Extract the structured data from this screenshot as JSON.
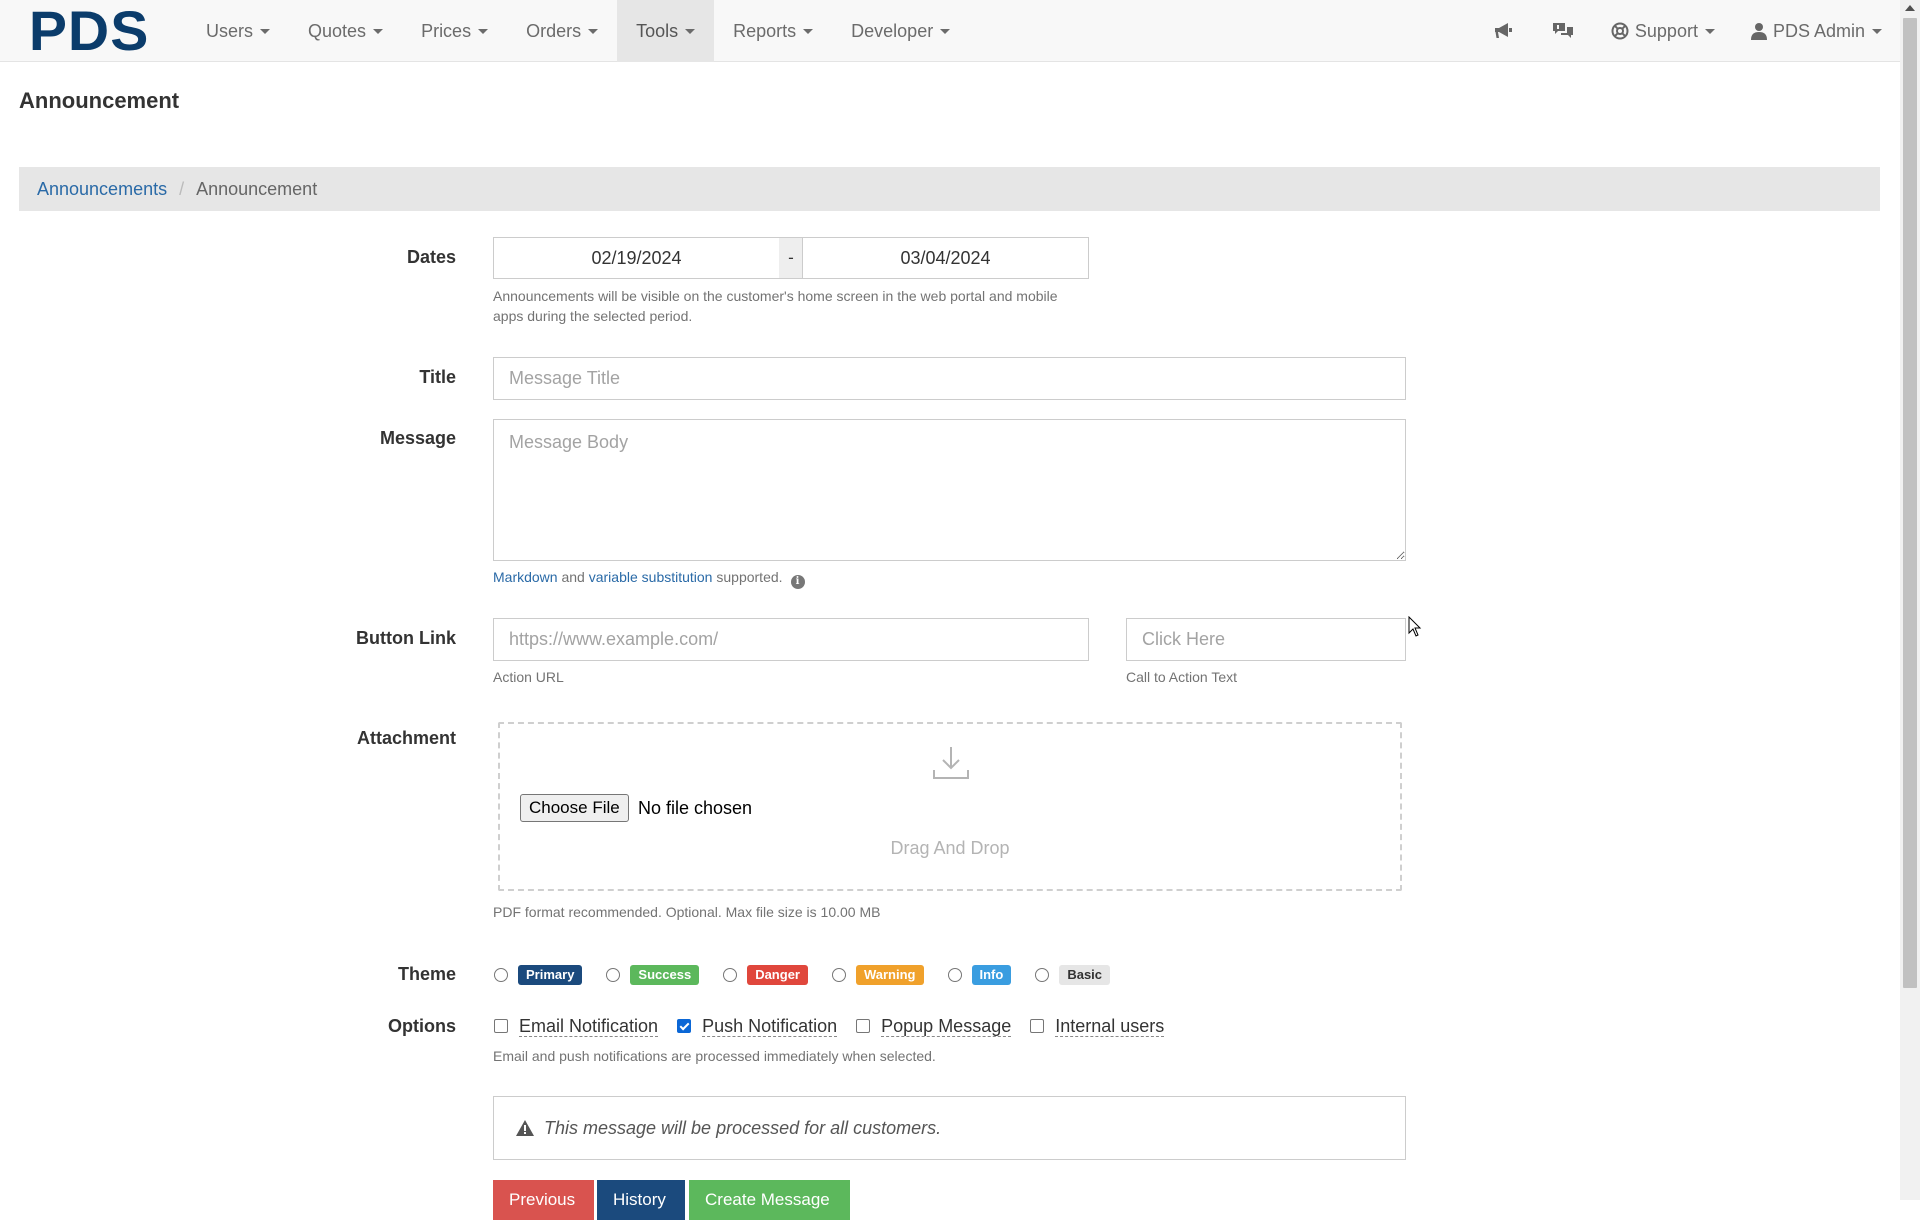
{
  "nav": {
    "brand": "PDS",
    "menu": [
      {
        "label": "Users"
      },
      {
        "label": "Quotes"
      },
      {
        "label": "Prices"
      },
      {
        "label": "Orders"
      },
      {
        "label": "Tools",
        "active": true
      },
      {
        "label": "Reports"
      },
      {
        "label": "Developer"
      }
    ],
    "right": {
      "announcements_icon": "bullhorn-icon",
      "messages_icon": "comments-icon",
      "support_label": "Support",
      "user_label": "PDS Admin"
    }
  },
  "page": {
    "title": "Announcement",
    "breadcrumb": {
      "parent": "Announcements",
      "current": "Announcement"
    }
  },
  "form": {
    "dates": {
      "label": "Dates",
      "start": "02/19/2024",
      "separator": "-",
      "end": "03/04/2024",
      "help_line1": "Announcements will be visible on the customer's home screen in the web portal and mobile",
      "help_line2": "apps during the selected period."
    },
    "title": {
      "label": "Title",
      "value": "",
      "placeholder": "Message Title"
    },
    "message": {
      "label": "Message",
      "value": "",
      "placeholder": "Message Body",
      "help_markdown": "Markdown",
      "help_and": " and ",
      "help_variable": "variable substitution",
      "help_supported": " supported.",
      "info_glyph": "i"
    },
    "button_link": {
      "label": "Button Link",
      "url_placeholder": "https://www.example.com/",
      "url_help": "Action URL",
      "text_placeholder": "Click Here",
      "text_help": "Call to Action Text"
    },
    "attachment": {
      "label": "Attachment",
      "choose_button": "Choose File",
      "file_status": "No file chosen",
      "drop_text": "Drag And Drop",
      "help": "PDF format recommended. Optional. Max file size is 10.00 MB"
    },
    "theme": {
      "label": "Theme",
      "options": [
        {
          "label": "Primary",
          "color": "#1b4a7d"
        },
        {
          "label": "Success",
          "color": "#5cb85c"
        },
        {
          "label": "Danger",
          "color": "#e0473c"
        },
        {
          "label": "Warning",
          "color": "#f0a12b"
        },
        {
          "label": "Info",
          "color": "#3a9de0"
        },
        {
          "label": "Basic",
          "color": "#e6e6e6"
        }
      ]
    },
    "options": {
      "label": "Options",
      "items": [
        {
          "label": "Email Notification",
          "checked": false
        },
        {
          "label": "Push Notification",
          "checked": true
        },
        {
          "label": "Popup Message",
          "checked": false
        },
        {
          "label": "Internal users",
          "checked": false
        }
      ],
      "help": "Email and push notifications are processed immediately when selected."
    },
    "alert": "This message will be processed for all customers.",
    "buttons": {
      "previous": "Previous",
      "history": "History",
      "create": "Create Message"
    }
  },
  "colors": {
    "brand": "#0b3c6b",
    "link": "#2a6aa7",
    "btn_previous": "#d9534f",
    "btn_history": "#1b4a7d",
    "btn_create": "#5cb85c"
  }
}
